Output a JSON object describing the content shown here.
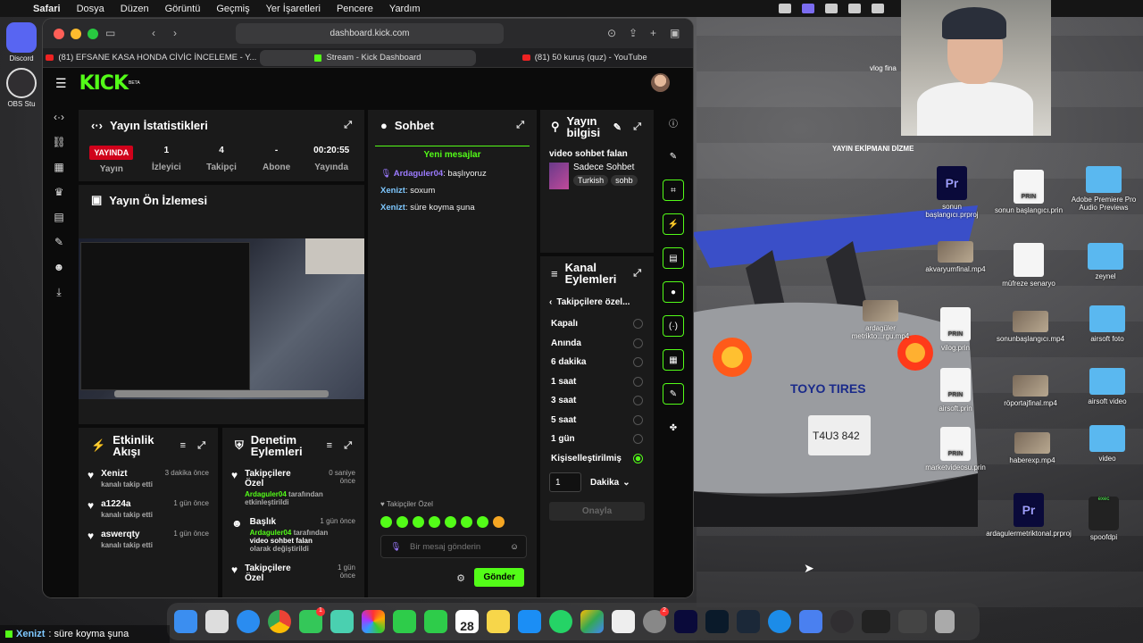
{
  "menubar": {
    "apple_icon": "apple-icon",
    "items": [
      "Safari",
      "Dosya",
      "Düzen",
      "Görüntü",
      "Geçmiş",
      "Yer İşaretleri",
      "Pencere",
      "Yardım"
    ]
  },
  "left_dock": [
    {
      "label": "Discord",
      "color": "#5865f2"
    },
    {
      "label": "OBS Stu",
      "color": "#302e31"
    }
  ],
  "browser": {
    "url": "dashboard.kick.com",
    "tabs": [
      {
        "label": "(81) EFSANE KASA HONDA CİVİC İNCELEME - Y...",
        "favicon": "youtube"
      },
      {
        "label": "Stream - Kick Dashboard",
        "favicon": "kick",
        "active": true
      },
      {
        "label": "(81) 50 kuruş (quz) - YouTube",
        "favicon": "youtube"
      }
    ]
  },
  "kick": {
    "logo": "KICK",
    "beta": "BETA",
    "stats_panel": {
      "title": "Yayın İstatistikleri",
      "badge": "YAYINDA",
      "badge_label": "Yayın",
      "stats": [
        {
          "value": "1",
          "label": "İzleyici"
        },
        {
          "value": "4",
          "label": "Takipçi"
        },
        {
          "value": "-",
          "label": "Abone"
        },
        {
          "value": "00:20:55",
          "label": "Yayında"
        }
      ]
    },
    "preview_panel": {
      "title": "Yayın Ön İzlemesi"
    },
    "chat_panel": {
      "title": "Sohbet",
      "new_messages": "Yeni mesajlar",
      "messages": [
        {
          "user": "Ardaguler04",
          "text": ": başlıyoruz"
        },
        {
          "user": "Xenizt",
          "text": ": soxum"
        },
        {
          "user": "Xenizt",
          "text": ": süre koyma şuna"
        }
      ],
      "followers_only": "Takipçiler Özel",
      "input_placeholder": "Bir mesaj gönderin",
      "send_label": "Gönder"
    },
    "stream_info": {
      "title": "Yayın bilgisi",
      "stream_title": "video sohbet falan",
      "category": "Sadece Sohbet",
      "tags": [
        "Turkish",
        "sohb"
      ]
    },
    "channel_actions": {
      "title": "Kanal Eylemleri",
      "back_label": "Takipçilere özel...",
      "options": [
        "Kapalı",
        "Anında",
        "6 dakika",
        "1 saat",
        "3 saat",
        "5 saat",
        "1 gün",
        "Kişiselleştirilmiş"
      ],
      "selected": "Kişiselleştirilmiş",
      "custom_value": "1",
      "unit": "Dakika",
      "confirm_label": "Onayla"
    },
    "activity": {
      "title": "Etkinlik Akışı",
      "items": [
        {
          "name": "Xenizt",
          "sub": "kanalı takip etti",
          "time": "3 dakika önce"
        },
        {
          "name": "a1224a",
          "sub": "kanalı takip etti",
          "time": "1 gün önce"
        },
        {
          "name": "aswerqty",
          "sub": "kanalı takip etti",
          "time": "1 gün önce"
        }
      ]
    },
    "moderation": {
      "title": "Denetim Eylemleri",
      "items": [
        {
          "name": "Takipçilere Özel",
          "user": "Ardaguler04",
          "sub": "tarafından etkinleştirildi",
          "time": "0 saniye önce"
        },
        {
          "name": "Başlık",
          "user": "Ardaguler04",
          "sub": "tarafından",
          "extra": "video sohbet falan",
          "tail": "olarak değiştirildi",
          "time": "1 gün önce"
        },
        {
          "name": "Takipçilere Özel",
          "time": "1 gün önce"
        }
      ]
    }
  },
  "desktop": {
    "icons": [
      {
        "label": "sonun başlangıcı.prproj",
        "type": "pr"
      },
      {
        "label": "sonun başlangıcı.prin",
        "type": "doc"
      },
      {
        "label": "Adobe Premiere Pro Audio Previews",
        "type": "folder"
      },
      {
        "label": "akvaryumfinal.mp4",
        "type": "photo"
      },
      {
        "label": "müfreze senaryo",
        "type": "doc"
      },
      {
        "label": "zeynel",
        "type": "folder"
      },
      {
        "label": "ardagüler metrikto...rgu.mp4",
        "type": "photo"
      },
      {
        "label": "vilog.prin",
        "type": "doc"
      },
      {
        "label": "sonunbaşlangıcı.mp4",
        "type": "photo"
      },
      {
        "label": "airsoft foto",
        "type": "folder"
      },
      {
        "label": "airsoft.prin",
        "type": "doc"
      },
      {
        "label": "röportajfinal.mp4",
        "type": "photo"
      },
      {
        "label": "airsoft video",
        "type": "folder"
      },
      {
        "label": "marketvideosu.prin",
        "type": "doc"
      },
      {
        "label": "haberexp.mp4",
        "type": "photo"
      },
      {
        "label": "video",
        "type": "folder"
      },
      {
        "label": "ardagulermetriktonal.prproj",
        "type": "pr"
      },
      {
        "label": "spoofdpi",
        "type": "exec"
      }
    ],
    "overlay_text": "YAYIN EKİPMANI DİZME",
    "vlog_label": "vlog fina",
    "plate_text": "T4U3 842",
    "tire_text": "TOYO TIRES"
  },
  "dock": {
    "calendar_day": "28",
    "badge_messages": "1",
    "badge_settings": "2"
  },
  "status": {
    "user": "Xenizt",
    "text": ": süre koyma şuna"
  }
}
